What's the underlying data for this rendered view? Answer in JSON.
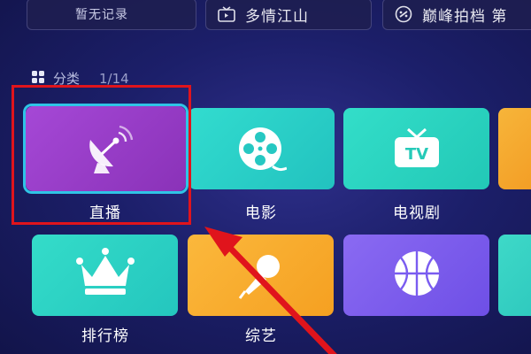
{
  "top_shelf": {
    "items": [
      {
        "label": "暂无记录",
        "icon": "history-icon"
      },
      {
        "label": "多情江山",
        "icon": "tv-icon"
      },
      {
        "label": "巅峰拍档 第",
        "icon": "link-icon"
      }
    ]
  },
  "category_section": {
    "title": "分类",
    "pager": "1/14",
    "icon": "grid-icon"
  },
  "categories": [
    {
      "label": "直播",
      "icon": "satellite-dish-icon",
      "color": "#9b3fc8",
      "focused": true
    },
    {
      "label": "电影",
      "icon": "film-reel-icon",
      "color": "#2fd2c8"
    },
    {
      "label": "电视剧",
      "icon": "tv-icon",
      "color": "#2fd8c4",
      "icon_text": "TV"
    },
    {
      "label": "排行榜",
      "icon": "crown-icon",
      "color": "#2fd0c8"
    },
    {
      "label": "综艺",
      "icon": "microphone-icon",
      "color": "#f7a52a"
    },
    {
      "label": "",
      "icon": "basketball-icon",
      "color": "#7a5cf0"
    }
  ],
  "annotation": {
    "highlight_color": "#e0141c",
    "focus_color": "#2fc4e6"
  }
}
